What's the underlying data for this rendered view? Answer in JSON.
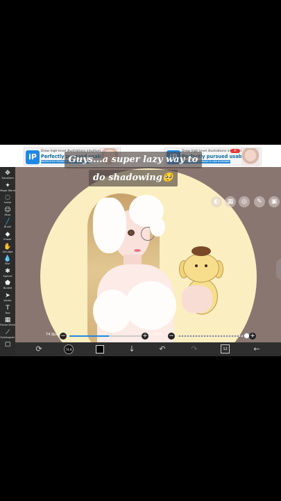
{
  "ad": {
    "logo": "iP",
    "line1": "Draw high-level illustrations intuitively!",
    "line2": "Perfectly pursued usability!",
    "line3": "ibisPaint for Windows is now available!"
  },
  "caption": {
    "line1": "Guys...a super lazy way to",
    "line2": "do shadowing🥺"
  },
  "tools": [
    {
      "icon": "move-icon",
      "glyph": "✥",
      "label": "Transform"
    },
    {
      "icon": "magic-wand-icon",
      "glyph": "✦",
      "label": "Magic Wand"
    },
    {
      "icon": "lasso-icon",
      "glyph": "◌",
      "label": "Lasso"
    },
    {
      "icon": "filter-icon",
      "glyph": "☺",
      "label": "Filter"
    },
    {
      "icon": "brush-icon",
      "glyph": "╱",
      "label": "Brush"
    },
    {
      "icon": "eraser-icon",
      "glyph": "◆",
      "label": "Eraser"
    },
    {
      "icon": "smudge-icon",
      "glyph": "✋",
      "label": "Smudge"
    },
    {
      "icon": "blur-icon",
      "glyph": "💧",
      "label": "Blur"
    },
    {
      "icon": "special-icon",
      "glyph": "✱",
      "label": "Special"
    },
    {
      "icon": "bucket-icon",
      "glyph": "⬟",
      "label": "Bucket"
    },
    {
      "icon": "vector-icon",
      "glyph": "➤",
      "label": "Vector"
    },
    {
      "icon": "text-icon",
      "glyph": "T",
      "label": "Text"
    },
    {
      "icon": "frame-divider-icon",
      "glyph": "▦",
      "label": "Frame Divider"
    },
    {
      "icon": "eyedropper-icon",
      "glyph": "⟋",
      "label": "Eyedropper"
    },
    {
      "icon": "canvas-icon",
      "glyph": "▢",
      "label": ""
    }
  ],
  "slider": {
    "size_label": "74.9px",
    "size_fraction": 0.55,
    "opacity_label": "100%",
    "opacity_fraction": 1.0
  },
  "bottom": {
    "brush_size_text": "74.9",
    "layer_count": "12"
  },
  "colors": {
    "canvas_bg": "#8a7670",
    "moon": "#fbeec0",
    "toolbar_bg": "#2b2b2b",
    "active_tool": "#3da9f5",
    "accent": "#1e88e5"
  }
}
